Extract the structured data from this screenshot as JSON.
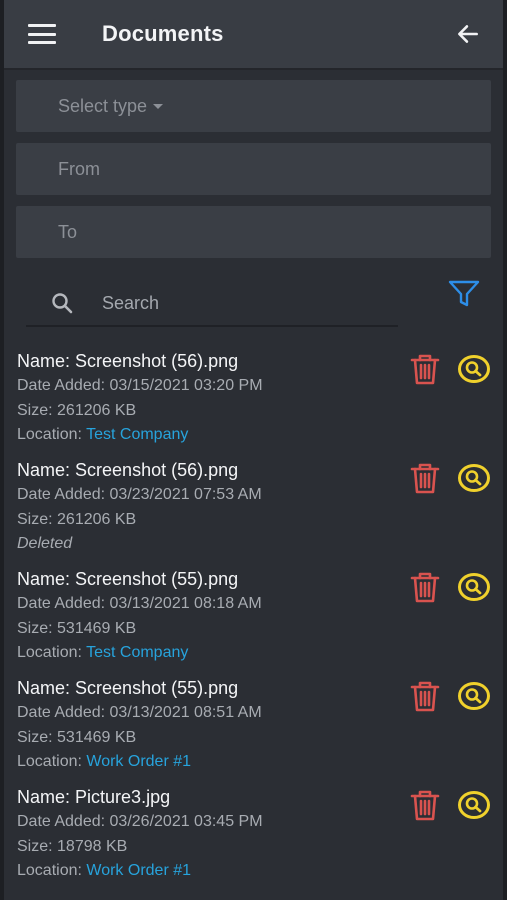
{
  "header": {
    "title": "Documents"
  },
  "filters": {
    "type_label": "Select type",
    "from_placeholder": "From",
    "to_placeholder": "To"
  },
  "search": {
    "placeholder": "Search"
  },
  "colors": {
    "accent": "#27a3dc",
    "delete": "#d9534f",
    "view": "#f0d12c",
    "filter": "#2d8ee8"
  },
  "labels": {
    "name": "Name:",
    "date": "Date Added:",
    "size": "Size:",
    "location": "Location:"
  },
  "documents": [
    {
      "name": "Screenshot (56).png",
      "date": "03/15/2021 03:20 PM",
      "size": "261206 KB",
      "location": "Test Company"
    },
    {
      "name": "Screenshot (56).png",
      "date": "03/23/2021 07:53 AM",
      "size": "261206 KB",
      "status": "Deleted"
    },
    {
      "name": "Screenshot (55).png",
      "date": "03/13/2021 08:18 AM",
      "size": "531469 KB",
      "location": "Test Company"
    },
    {
      "name": "Screenshot (55).png",
      "date": "03/13/2021 08:51 AM",
      "size": "531469 KB",
      "location": "Work Order #1"
    },
    {
      "name": "Picture3.jpg",
      "date": "03/26/2021 03:45 PM",
      "size": "18798 KB",
      "location": "Work Order #1"
    }
  ]
}
